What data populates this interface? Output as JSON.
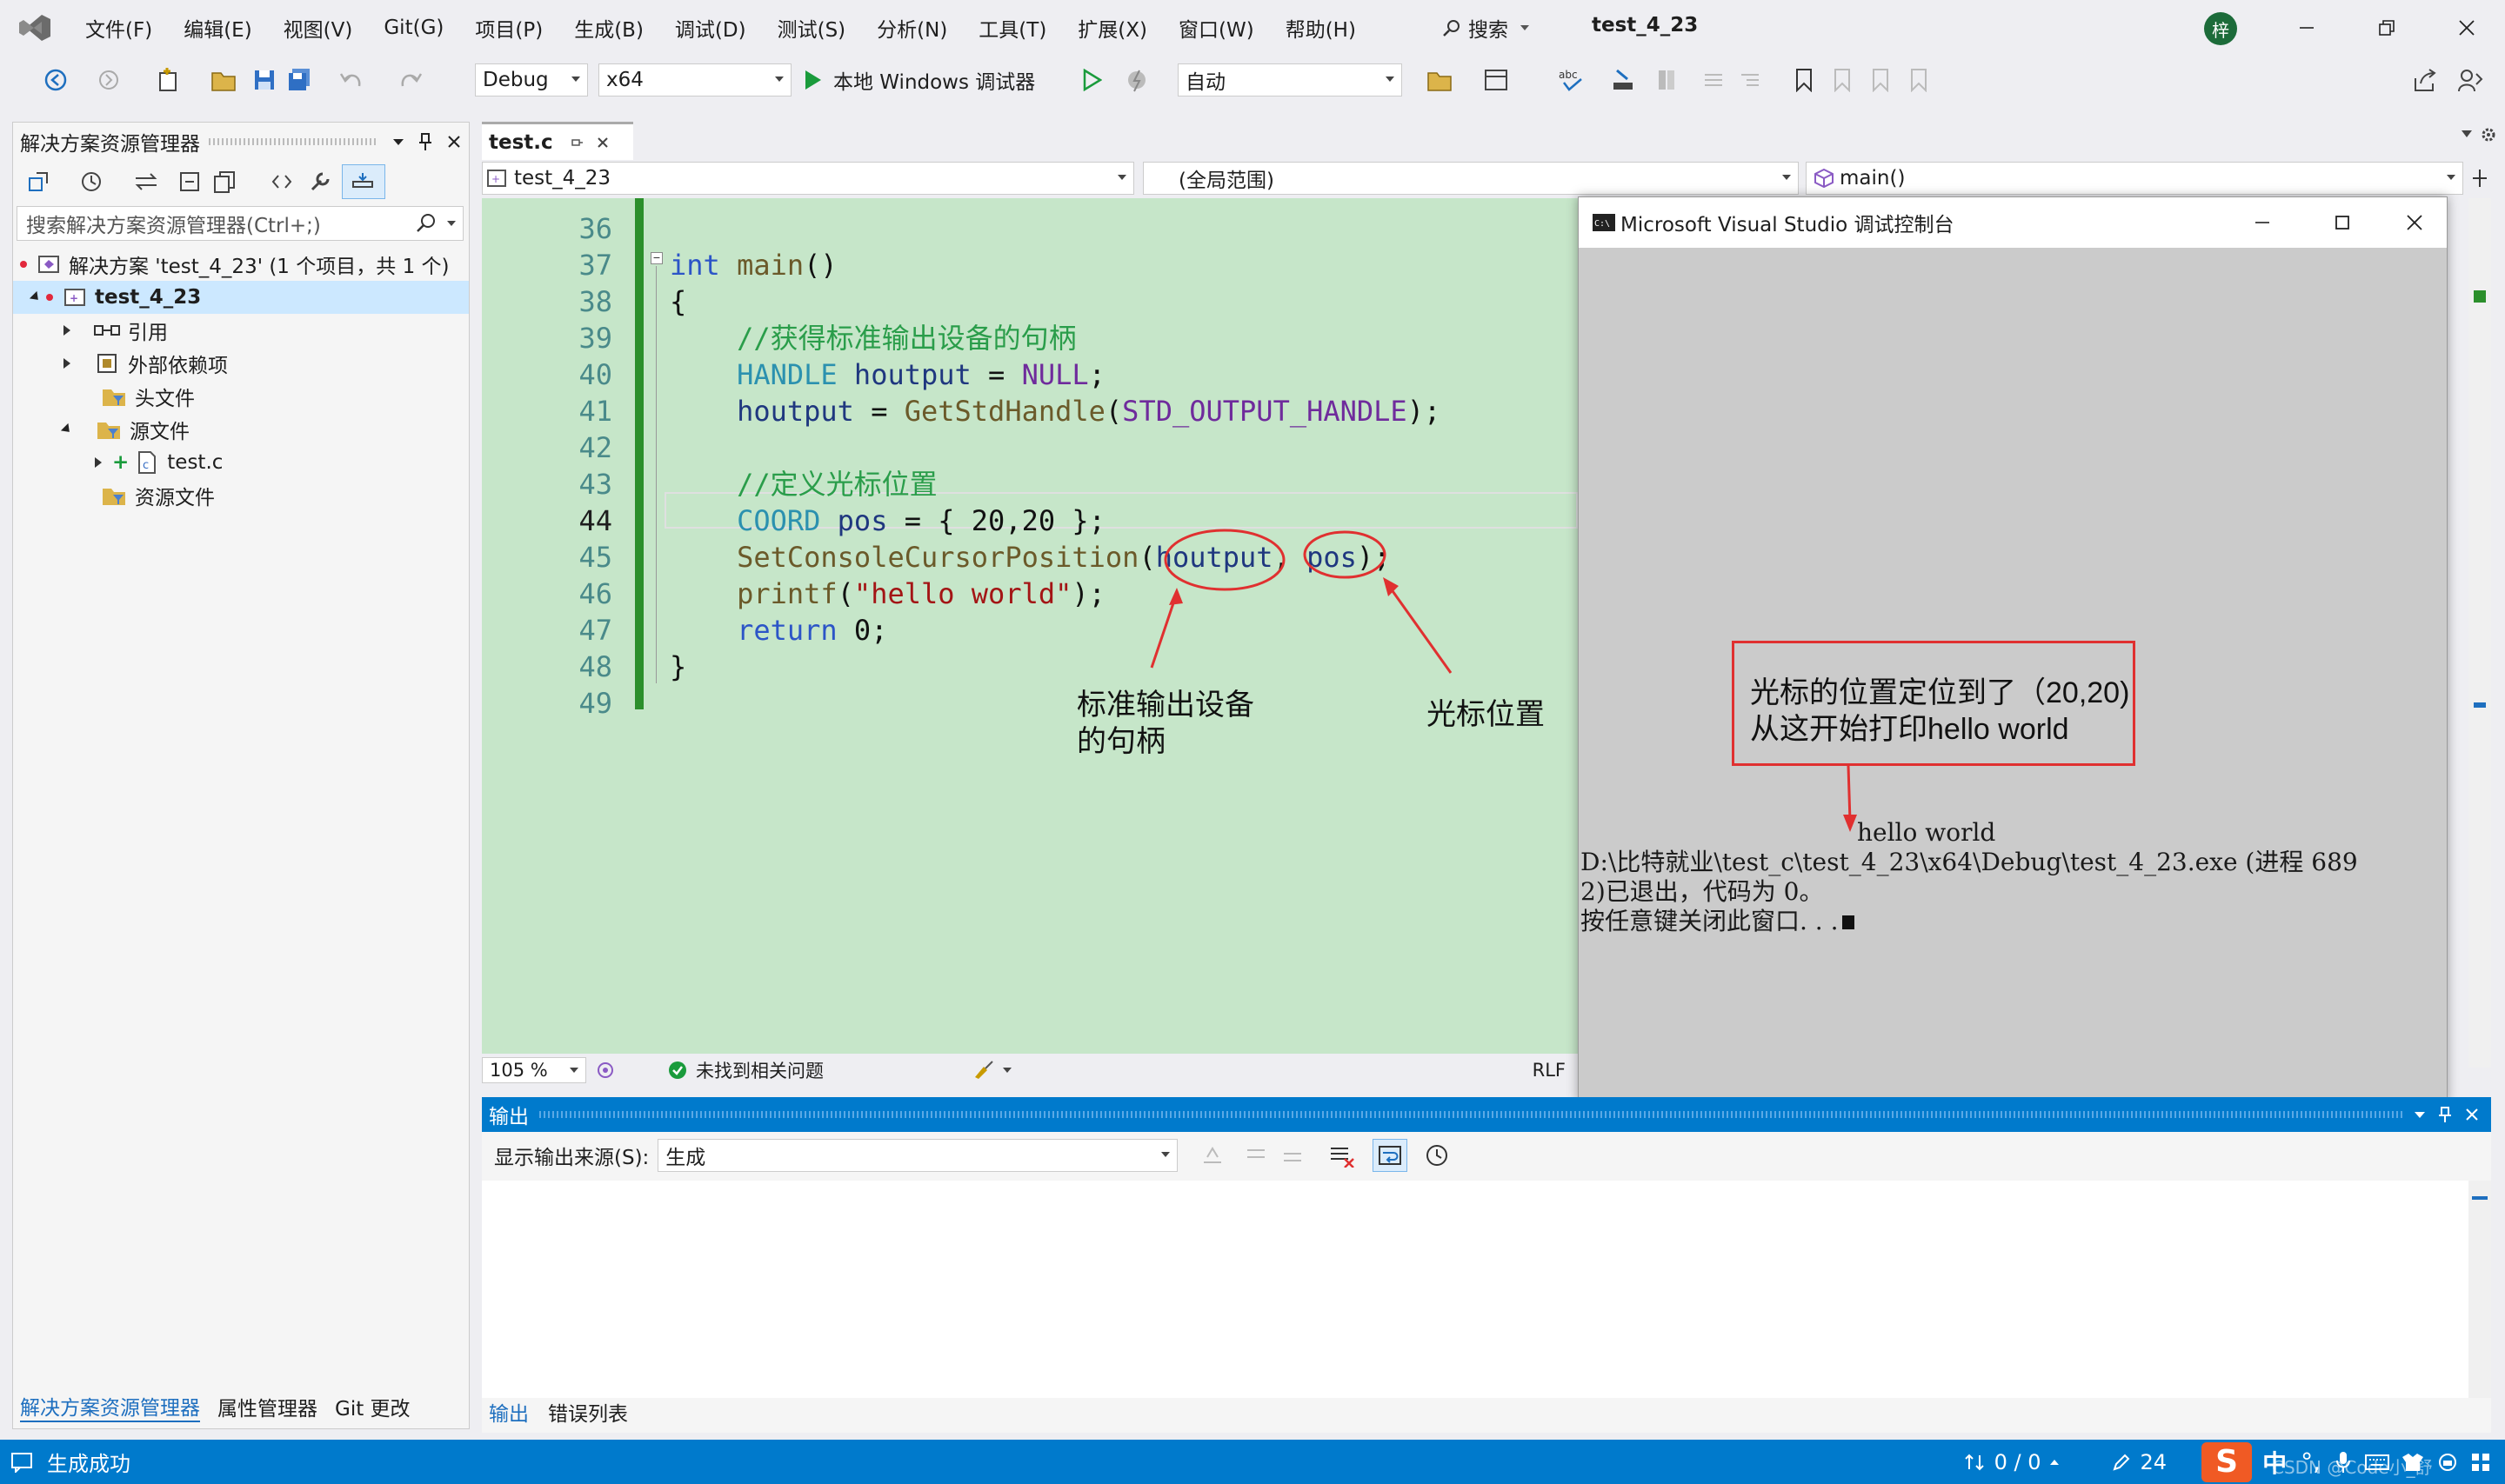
{
  "menu": [
    "文件(F)",
    "编辑(E)",
    "视图(V)",
    "Git(G)",
    "项目(P)",
    "生成(B)",
    "调试(D)",
    "测试(S)",
    "分析(N)",
    "工具(T)",
    "扩展(X)",
    "窗口(W)",
    "帮助(H)"
  ],
  "search_label": "搜索",
  "window_title": "test_4_23",
  "avatar_letter": "梓",
  "toolbar": {
    "config": "Debug",
    "platform": "x64",
    "run_label": "本地 Windows 调试器",
    "auto_label": "自动"
  },
  "solution_explorer": {
    "title": "解决方案资源管理器",
    "search_placeholder": "搜索解决方案资源管理器(Ctrl+;)",
    "tree": [
      {
        "label": "解决方案 'test_4_23' (1 个项目，共 1 个)"
      },
      {
        "label": "test_4_23"
      },
      {
        "label": "引用"
      },
      {
        "label": "外部依赖项"
      },
      {
        "label": "头文件"
      },
      {
        "label": "源文件"
      },
      {
        "label": "test.c"
      },
      {
        "label": "资源文件"
      }
    ],
    "tabs": [
      "解决方案资源管理器",
      "属性管理器",
      "Git 更改"
    ]
  },
  "editor": {
    "tab_name": "test.c",
    "nav_project": "test_4_23",
    "nav_scope": "(全局范围)",
    "nav_member": "main()",
    "line_numbers": [
      "36",
      "37",
      "38",
      "39",
      "40",
      "41",
      "42",
      "43",
      "44",
      "45",
      "46",
      "47",
      "48",
      "49"
    ],
    "zoom": "105 %",
    "issues": "未找到相关问题",
    "eol": "RLF"
  },
  "annotations": {
    "handle_label_line1": "标准输出设备",
    "handle_label_line2": "的句柄",
    "pos_label": "光标位置",
    "box_line1": "光标的位置定位到了（20,20)",
    "box_line2": "从这开始打印hello world"
  },
  "console": {
    "title": "Microsoft Visual Studio 调试控制台",
    "hello": "hello world",
    "line1": "D:\\比特就业\\test_c\\test_4_23\\x64\\Debug\\test_4_23.exe (进程 689",
    "line2": "2)已退出，代码为 0。",
    "line3": "按任意键关闭此窗口. . ."
  },
  "output": {
    "title": "输出",
    "source_label": "显示输出来源(S):",
    "source_value": "生成",
    "tabs": [
      "输出",
      "错误列表"
    ]
  },
  "status": {
    "build": "生成成功",
    "changes": "0 / 0",
    "edits": "24",
    "watermark": "CSDN @Code小_舒"
  }
}
